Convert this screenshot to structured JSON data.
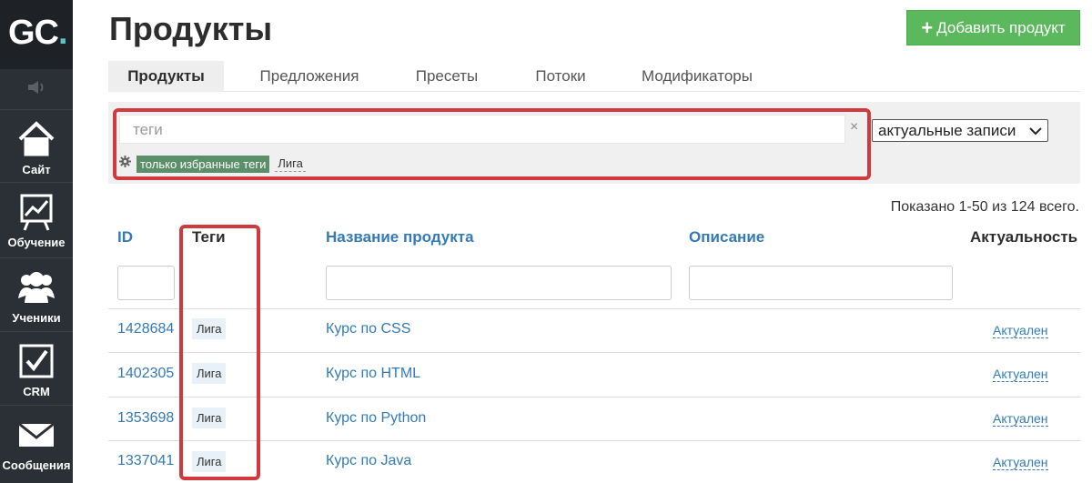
{
  "sidebar": {
    "logo": {
      "text": "GC",
      "dot": "."
    },
    "items": [
      {
        "label": "Сайт",
        "icon": "home-icon"
      },
      {
        "label": "Обучение",
        "icon": "chart-board-icon"
      },
      {
        "label": "Ученики",
        "icon": "users-icon"
      },
      {
        "label": "CRM",
        "icon": "checkbox-icon"
      },
      {
        "label": "Сообщения",
        "icon": "envelope-icon"
      }
    ]
  },
  "header": {
    "title": "Продукты",
    "add_button": {
      "plus": "+",
      "label": "Добавить продукт"
    }
  },
  "tabs": [
    {
      "label": "Продукты",
      "active": true
    },
    {
      "label": "Предложения",
      "active": false
    },
    {
      "label": "Пресеты",
      "active": false
    },
    {
      "label": "Потоки",
      "active": false
    },
    {
      "label": "Модификаторы",
      "active": false
    }
  ],
  "filter": {
    "tags_placeholder": "теги",
    "clear": "×",
    "favorite_chip": "только избранные теги",
    "tag_chip": "Лига",
    "select_value": "актуальные записи",
    "select_arrow": "⌄"
  },
  "table": {
    "summary": "Показано 1-50 из 124 всего.",
    "columns": {
      "id": "ID",
      "tags": "Теги",
      "name": "Название продукта",
      "description": "Описание",
      "status": "Актуальность"
    },
    "rows": [
      {
        "id": "1428684",
        "tag": "Лига",
        "name": "Курс по CSS",
        "status": "Актуален"
      },
      {
        "id": "1402305",
        "tag": "Лига",
        "name": "Курс по HTML",
        "status": "Актуален"
      },
      {
        "id": "1353698",
        "tag": "Лига",
        "name": "Курс по Python",
        "status": "Актуален"
      },
      {
        "id": "1337041",
        "tag": "Лига",
        "name": "Курс по Java",
        "status": "Актуален"
      }
    ]
  },
  "colors": {
    "sidebar": "#2b3036",
    "accent_link": "#337ab7",
    "add_button": "#5cb85c",
    "highlight": "#d0393d",
    "favorite_chip": "#5a8f69"
  }
}
